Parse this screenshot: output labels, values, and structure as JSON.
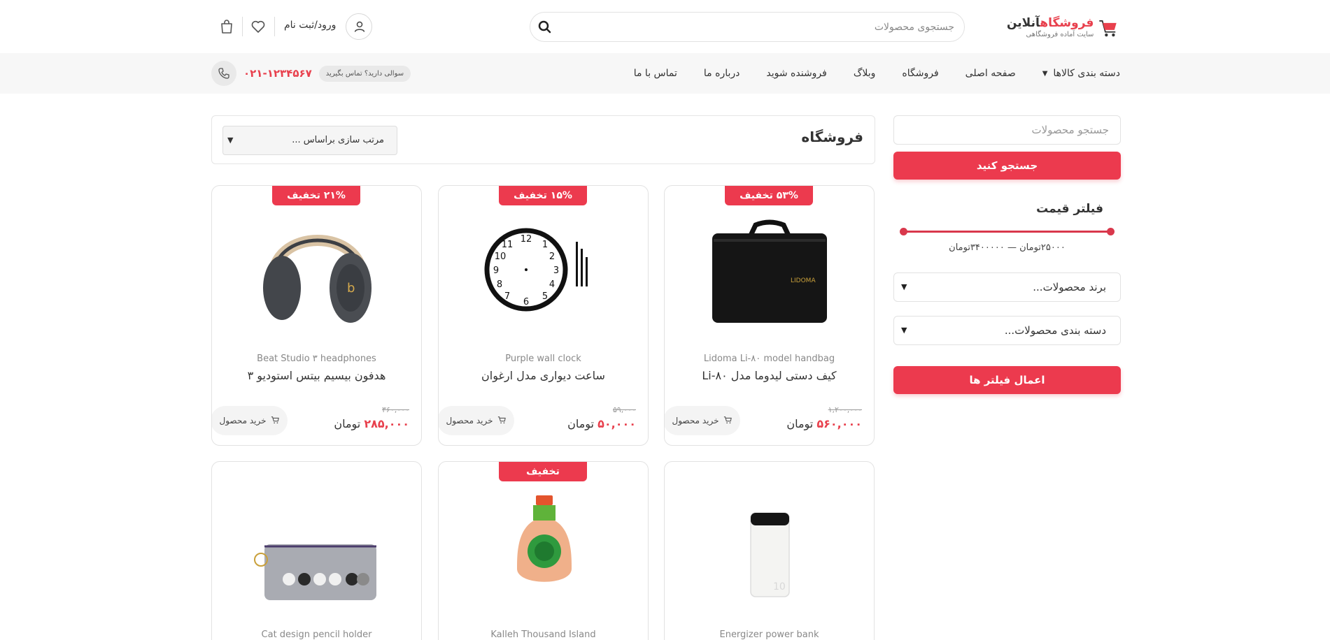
{
  "header": {
    "logo_title_accent": "فروشگاه",
    "logo_title_rest": "آنلاین",
    "logo_subtitle": "سایت آماده فروشگاهی",
    "search_placeholder": "جستجوی محصولات",
    "login_label": "ورود/ثبت نام"
  },
  "nav": {
    "items": [
      "دسته بندی کالاها",
      "صفحه اصلی",
      "فروشگاه",
      "وبلاگ",
      "فروشنده شوید",
      "درباره ما",
      "تماس با ما"
    ],
    "ask_badge": "سوالی دارید؟ تماس بگیرید",
    "phone": "۰۲۱-۱۲۳۴۵۶۷"
  },
  "sidebar": {
    "search_placeholder": "جستجو محصولات",
    "search_button": "جستجو کنید",
    "price_filter_title": "فیلتر قیمت",
    "price_range_text": "۲۵۰۰۰تومان — ۳۴۰۰۰۰۰تومان",
    "price_min": 25000,
    "price_max": 3400000,
    "brand_select": "برند محصولات...",
    "category_select": "دسته بندی محصولات...",
    "apply_button": "اعمال فیلتر ها"
  },
  "main": {
    "title": "فروشگاه",
    "sort_label": "مرتب سازی براساس ..."
  },
  "products": [
    {
      "badge": "۵۳% تخفیف",
      "en_name": "Lidoma Li-۸۰ model handbag",
      "fa_name": "کیف دستی لیدوما مدل Li-۸۰",
      "old_price": "۱,۲۰۰,۰۰۰",
      "new_price": "۵۶۰,۰۰۰",
      "currency": "تومان",
      "buy_label": "خرید محصول",
      "image": "handbag"
    },
    {
      "badge": "۱۵% تخفیف",
      "en_name": "Purple wall clock",
      "fa_name": "ساعت دیواری مدل ارغوان",
      "old_price": "۵۹,۰۰۰",
      "new_price": "۵۰,۰۰۰",
      "currency": "تومان",
      "buy_label": "خرید محصول",
      "image": "clock"
    },
    {
      "badge": "۲۱% تخفیف",
      "en_name": "Beat Studio ۳ headphones",
      "fa_name": "هدفون بیسیم بیتس استودیو ۳",
      "old_price": "۳۶۰,۰۰۰",
      "new_price": "۲۸۵,۰۰۰",
      "currency": "تومان",
      "buy_label": "خرید محصول",
      "image": "headphones"
    },
    {
      "badge": "",
      "en_name": "Energizer power bank",
      "image": "powerbank"
    },
    {
      "badge": "تخفیف",
      "en_name": "Kalleh Thousand Island",
      "image": "sauce"
    },
    {
      "badge": "",
      "en_name": "Cat design pencil holder",
      "image": "pencilcase"
    }
  ],
  "colors": {
    "accent": "#ec3a4e",
    "nav_bg": "#f7f7f7"
  }
}
